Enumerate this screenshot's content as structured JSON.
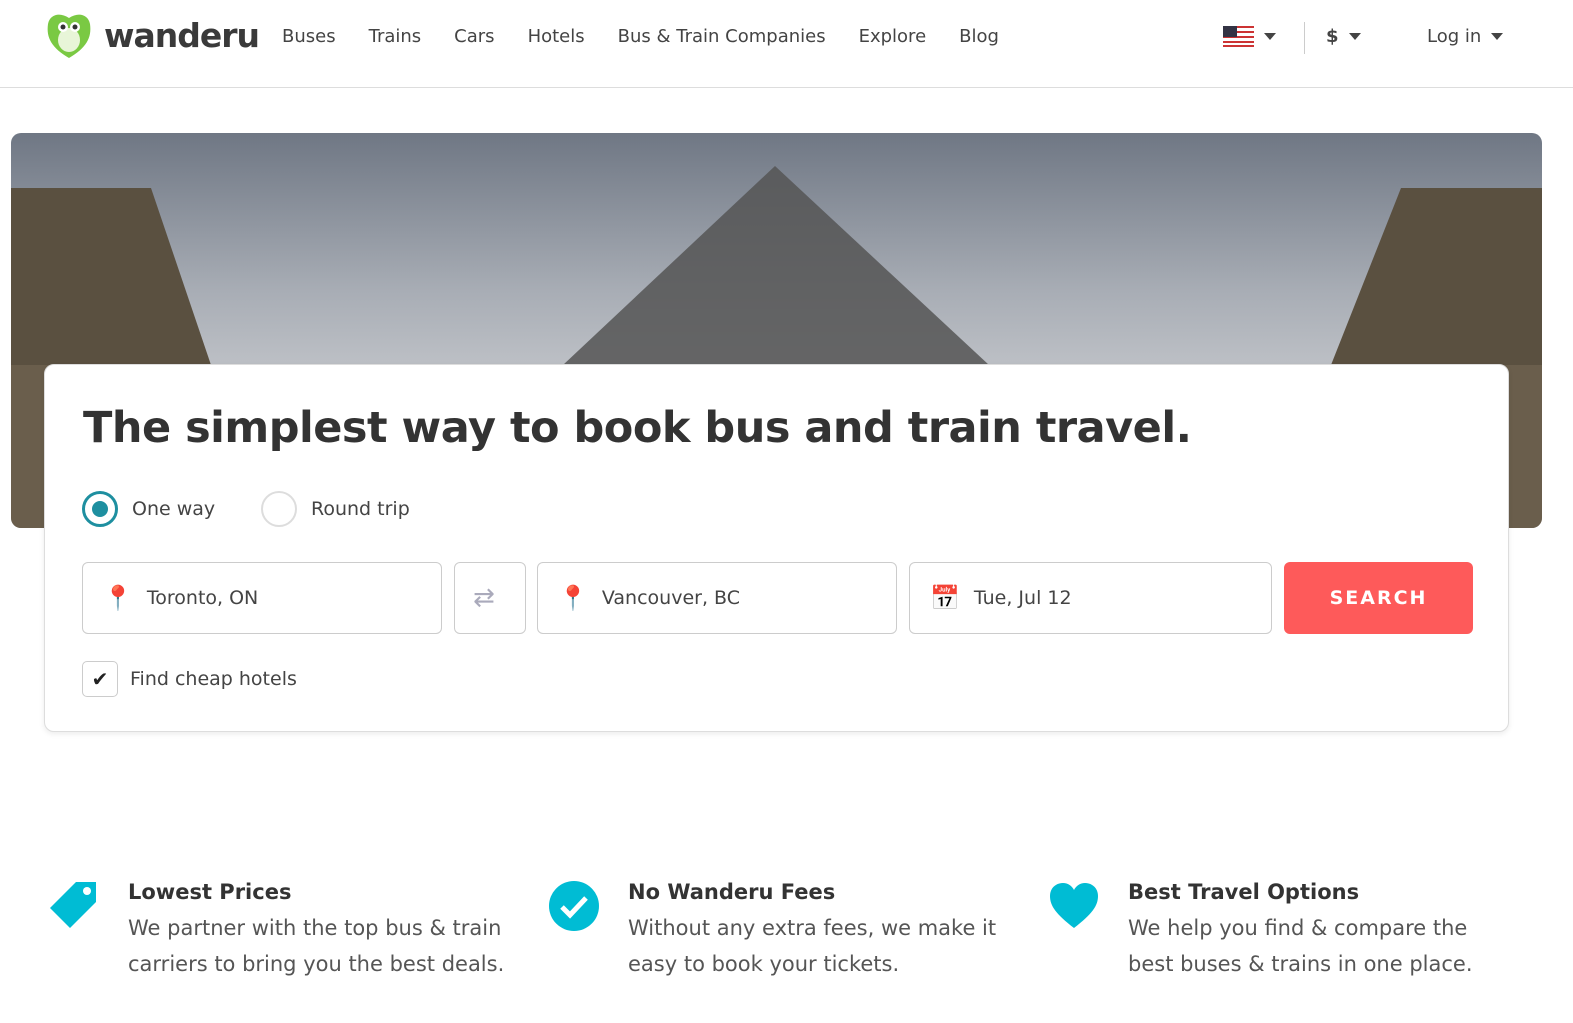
{
  "brand": {
    "name": "wanderu",
    "color": "#7ac943"
  },
  "nav": {
    "links": [
      "Buses",
      "Trains",
      "Cars",
      "Hotels",
      "Bus & Train Companies",
      "Explore",
      "Blog"
    ],
    "currency": "$",
    "login": "Log in"
  },
  "search": {
    "title": "The simplest way to book bus and train travel.",
    "trip_options": [
      "One way",
      "Round trip"
    ],
    "selected_trip": "One way",
    "origin": "Toronto, ON",
    "destination": "Vancouver, BC",
    "date": "Tue, Jul 12",
    "search_label": "SEARCH",
    "hotels_label": "Find cheap hotels",
    "hotels_checked": true,
    "accent": "#fe5a5a"
  },
  "features": [
    {
      "title": "Lowest Prices",
      "text": "We partner with the top bus & train carriers to bring you the best deals.",
      "icon": "tag-icon"
    },
    {
      "title": "No Wanderu Fees",
      "text": "Without any extra fees, we make it easy to book your tickets.",
      "icon": "check-circle-icon"
    },
    {
      "title": "Best Travel Options",
      "text": "We help you find & compare the best buses & trains in one place.",
      "icon": "heart-icon"
    }
  ]
}
